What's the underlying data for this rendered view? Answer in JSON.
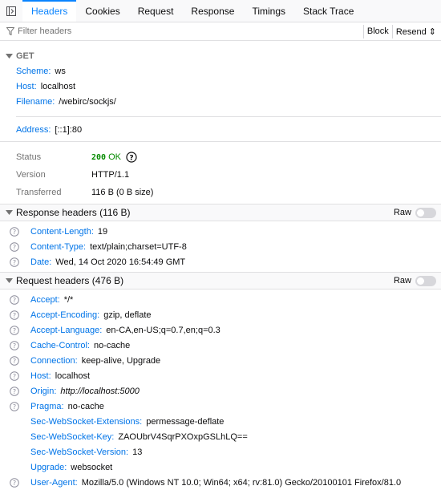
{
  "tabs": [
    "Headers",
    "Cookies",
    "Request",
    "Response",
    "Timings",
    "Stack Trace"
  ],
  "filter": {
    "placeholder": "Filter headers",
    "block_label": "Block",
    "resend_label": "Resend ⇕"
  },
  "summary": {
    "method": "GET",
    "scheme_key": "Scheme:",
    "scheme": "ws",
    "host_key": "Host:",
    "host": "localhost",
    "filename_key": "Filename:",
    "filename": "/webirc/sockjs/",
    "address_key": "Address:",
    "address": "[::1]:80"
  },
  "status": {
    "status_label": "Status",
    "code": "200",
    "text": "OK",
    "version_label": "Version",
    "version": "HTTP/1.1",
    "transferred_label": "Transferred",
    "transferred": "116 B (0 B size)"
  },
  "response_headers": {
    "title": "Response headers (116 B)",
    "raw_label": "Raw",
    "items": [
      {
        "name": "Content-Length:",
        "value": "19"
      },
      {
        "name": "Content-Type:",
        "value": "text/plain;charset=UTF-8"
      },
      {
        "name": "Date:",
        "value": "Wed, 14 Oct 2020 16:54:49 GMT"
      }
    ]
  },
  "request_headers": {
    "title": "Request headers (476 B)",
    "raw_label": "Raw",
    "items": [
      {
        "name": "Accept:",
        "value": "*/*"
      },
      {
        "name": "Accept-Encoding:",
        "value": "gzip, deflate"
      },
      {
        "name": "Accept-Language:",
        "value": "en-CA,en-US;q=0.7,en;q=0.3"
      },
      {
        "name": "Cache-Control:",
        "value": "no-cache"
      },
      {
        "name": "Connection:",
        "value": "keep-alive, Upgrade"
      },
      {
        "name": "Host:",
        "value": "localhost"
      },
      {
        "name": "Origin:",
        "value": "http://localhost:5000"
      },
      {
        "name": "Pragma:",
        "value": "no-cache"
      },
      {
        "name": "Sec-WebSocket-Extensions:",
        "value": "permessage-deflate"
      },
      {
        "name": "Sec-WebSocket-Key:",
        "value": "ZAOUbrV4SqrPXOxpGSLhLQ=="
      },
      {
        "name": "Sec-WebSocket-Version:",
        "value": "13"
      },
      {
        "name": "Upgrade:",
        "value": "websocket"
      },
      {
        "name": "User-Agent:",
        "value": "Mozilla/5.0 (Windows NT 10.0; Win64; x64; rv:81.0) Gecko/20100101 Firefox/81.0"
      }
    ]
  },
  "colors": {
    "accent": "#0a84ff",
    "key": "#0074e8",
    "ok": "#058b00"
  }
}
